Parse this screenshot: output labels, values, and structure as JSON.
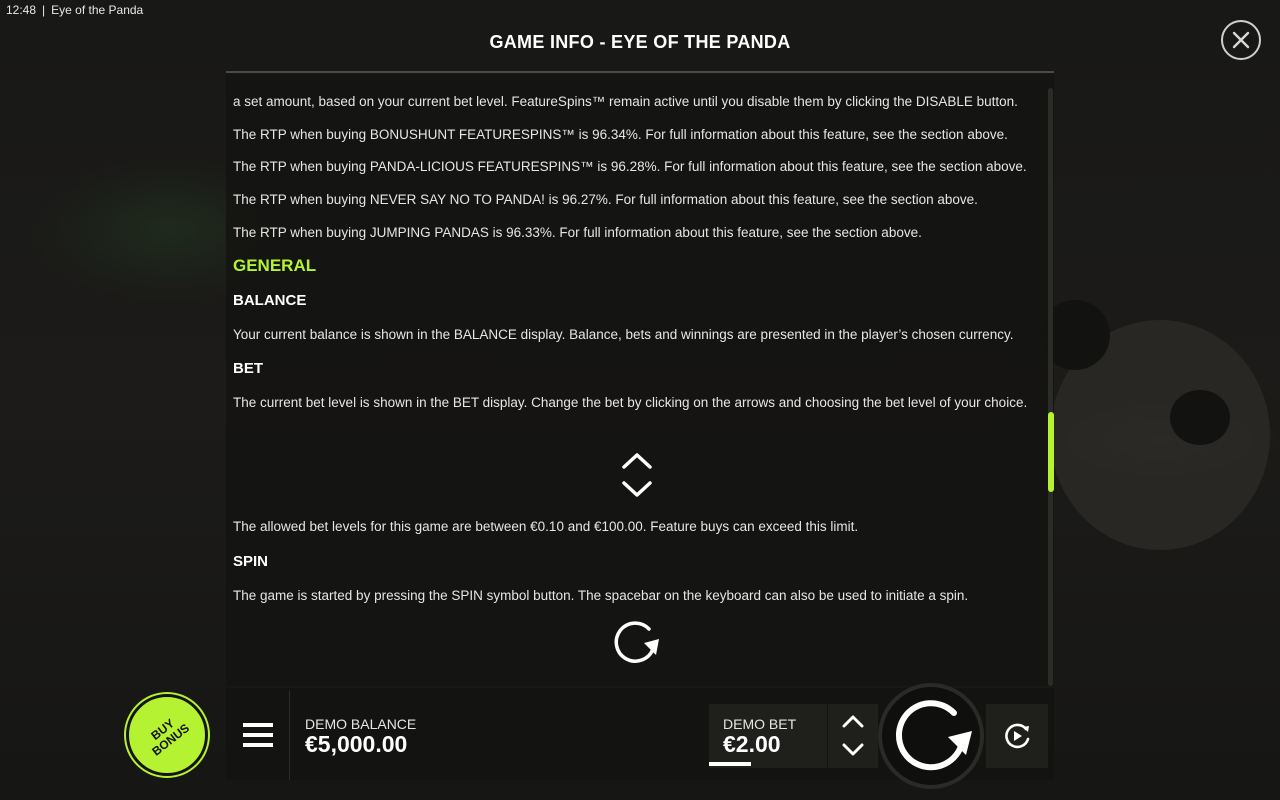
{
  "status_bar": {
    "time": "12:48",
    "separator": "|",
    "app_title": "Eye of the Panda"
  },
  "dialog": {
    "title": "GAME INFO - EYE OF THE PANDA",
    "close_icon": "close-icon"
  },
  "content": {
    "paragraphs_top": [
      "a set amount, based on your current bet level. FeatureSpins™ remain active until you disable them by clicking the DISABLE button.",
      "The RTP when buying BONUSHUNT FEATURESPINS™ is 96.34%. For full information about this feature, see the section above.",
      "The RTP when buying PANDA-LICIOUS FEATURESPINS™ is 96.28%. For full information about this feature, see the section above.",
      "The RTP when buying NEVER SAY NO TO PANDA! is 96.27%. For full information about this feature, see the section above.",
      "The RTP when buying JUMPING PANDAS is 96.33%. For full information about this feature, see the section above."
    ],
    "general_heading": "GENERAL",
    "balance_heading": "BALANCE",
    "balance_text": "Your current balance is shown in the BALANCE display. Balance, bets and winnings are presented in the player’s chosen currency.",
    "bet_heading": "BET",
    "bet_text": "The current bet level is shown in the BET display. Change the bet by clicking on the arrows and choosing the bet level of your choice.",
    "bet_limits_text": "The allowed bet levels for this game are between €0.10 and €100.00. Feature buys can exceed this limit.",
    "spin_heading": "SPIN",
    "spin_text": "The game is started by pressing the SPIN symbol button. The spacebar on the keyboard can also be used to initiate a spin."
  },
  "bottom_bar": {
    "buy_bonus_label": "BUY BONUS",
    "balance_label": "DEMO BALANCE",
    "balance_value": "€5,000.00",
    "bet_label": "DEMO BET",
    "bet_value": "€2.00"
  },
  "colors": {
    "accent": "#b5f232",
    "background": "#141412",
    "text": "#ffffff"
  }
}
